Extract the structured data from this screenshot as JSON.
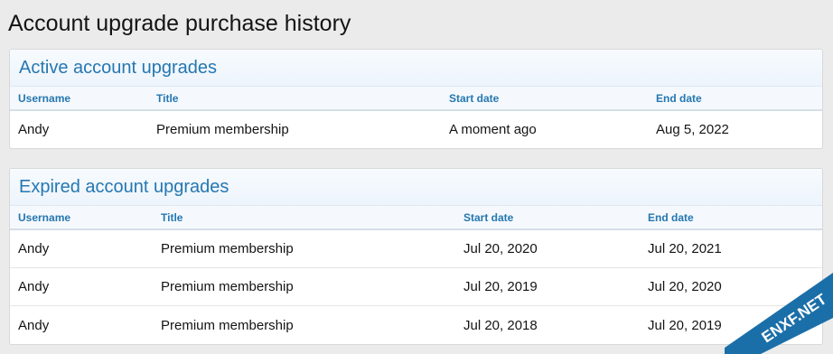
{
  "page": {
    "title": "Account upgrade purchase history"
  },
  "active": {
    "title": "Active account upgrades",
    "columns": [
      "Username",
      "Title",
      "Start date",
      "End date"
    ],
    "rows": [
      [
        "Andy",
        "Premium membership",
        "A moment ago",
        "Aug 5, 2022"
      ]
    ]
  },
  "expired": {
    "title": "Expired account upgrades",
    "columns": [
      "Username",
      "Title",
      "Start date",
      "End date"
    ],
    "rows": [
      [
        "Andy",
        "Premium membership",
        "Jul 20, 2020",
        "Jul 20, 2021"
      ],
      [
        "Andy",
        "Premium membership",
        "Jul 20, 2019",
        "Jul 20, 2020"
      ],
      [
        "Andy",
        "Premium membership",
        "Jul 20, 2018",
        "Jul 20, 2019"
      ]
    ]
  },
  "watermark": {
    "text": "ENXF.NET",
    "color": "#1b6fa8"
  }
}
